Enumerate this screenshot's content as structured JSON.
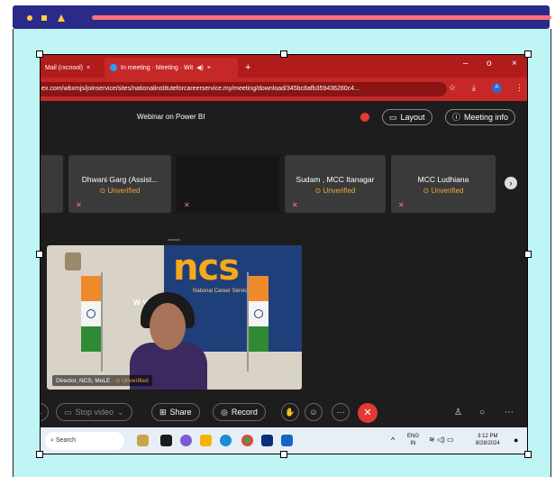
{
  "browser": {
    "tabs": [
      {
        "label": "Mail (rxcnool)",
        "close": "×"
      },
      {
        "label": "In meeting · Meeting · Wit",
        "close": "×"
      }
    ],
    "new_tab": "+",
    "url": "ex.com/wbxmjs/joinservice/sites/nationalinstituteforcareerservice.my/meeting/download/345bc8afb359436280c4...",
    "window_controls": [
      "–",
      "o",
      "×"
    ]
  },
  "meeting": {
    "title": "Webinar on Power BI",
    "layout_label": "Layout",
    "meeting_info_label": "Meeting info",
    "participants": [
      {
        "name": "Dhwani Garg (Assist...",
        "status": "Unverified"
      },
      {
        "name": "Sudam , MCC Itanagar",
        "status": "Unverified"
      },
      {
        "name": "MCC Ludhiana",
        "status": "Unverified"
      }
    ],
    "video": {
      "logo": "ncs",
      "logo_sub": "National Career Service",
      "website": "w           v.in",
      "speaker_label": "Director, NCS, MoLE",
      "speaker_status": "Unverified"
    },
    "controls": {
      "stop_video": "Stop video",
      "share": "Share",
      "record": "Record"
    }
  },
  "taskbar": {
    "search_placeholder": "Search",
    "lang_top": "ENG",
    "lang_bottom": "IN",
    "time": "3:12 PM",
    "date": "8/28/2024"
  },
  "colors": {
    "browser_red": "#c62828",
    "end_call": "#e53935",
    "unverified": "#f1a43c",
    "canvas": "#bff5f4"
  }
}
